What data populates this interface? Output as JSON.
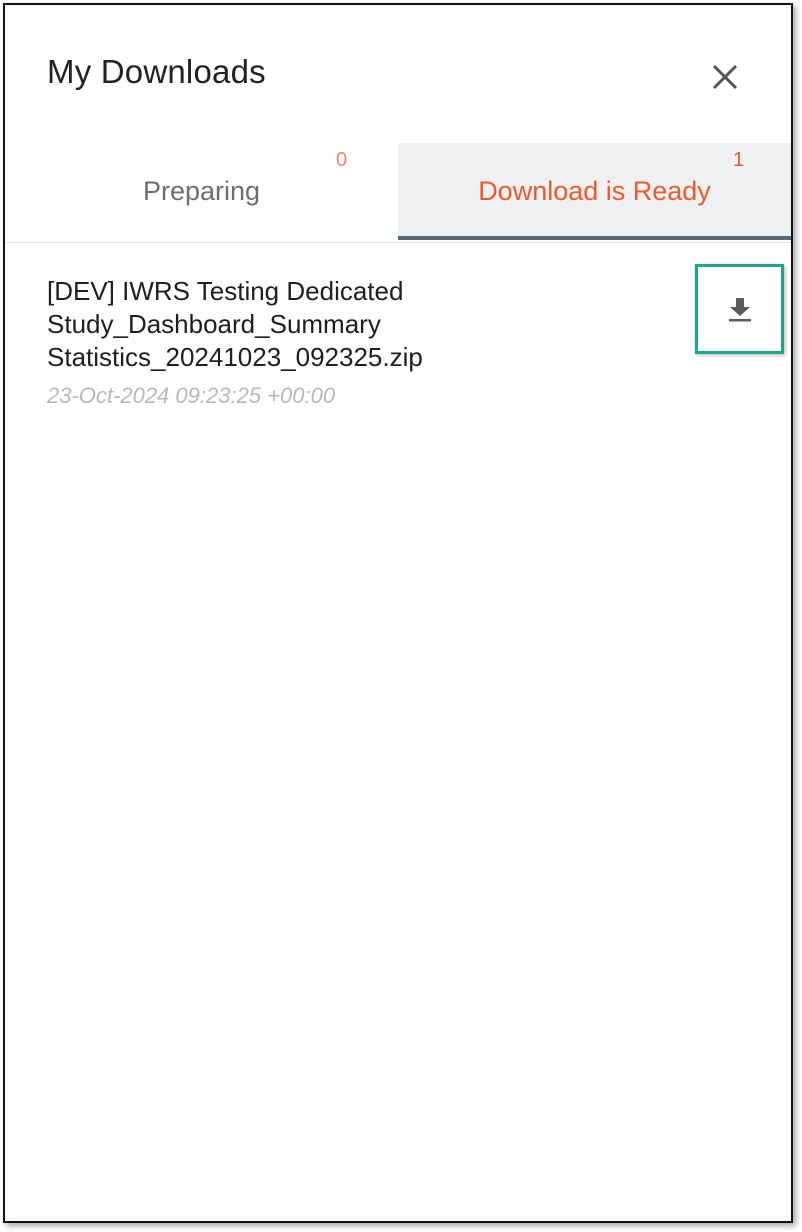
{
  "panel": {
    "title": "My Downloads",
    "close_icon": "close-icon"
  },
  "tabs": [
    {
      "label": "Preparing",
      "count": "0",
      "active": false
    },
    {
      "label": "Download is Ready",
      "count": "1",
      "active": true
    }
  ],
  "downloads": [
    {
      "file_name": "[DEV] IWRS Testing Dedicated Study_Dashboard_Summary Statistics_20241023_092325.zip",
      "timestamp": "23-Oct-2024 09:23:25 +00:00",
      "action_icon": "download-icon"
    }
  ],
  "colors": {
    "accent": "#f05a2a",
    "highlight_border": "#1aa58f",
    "active_tab_bg": "#eef0f2",
    "active_tab_underline": "#5a6b77"
  }
}
